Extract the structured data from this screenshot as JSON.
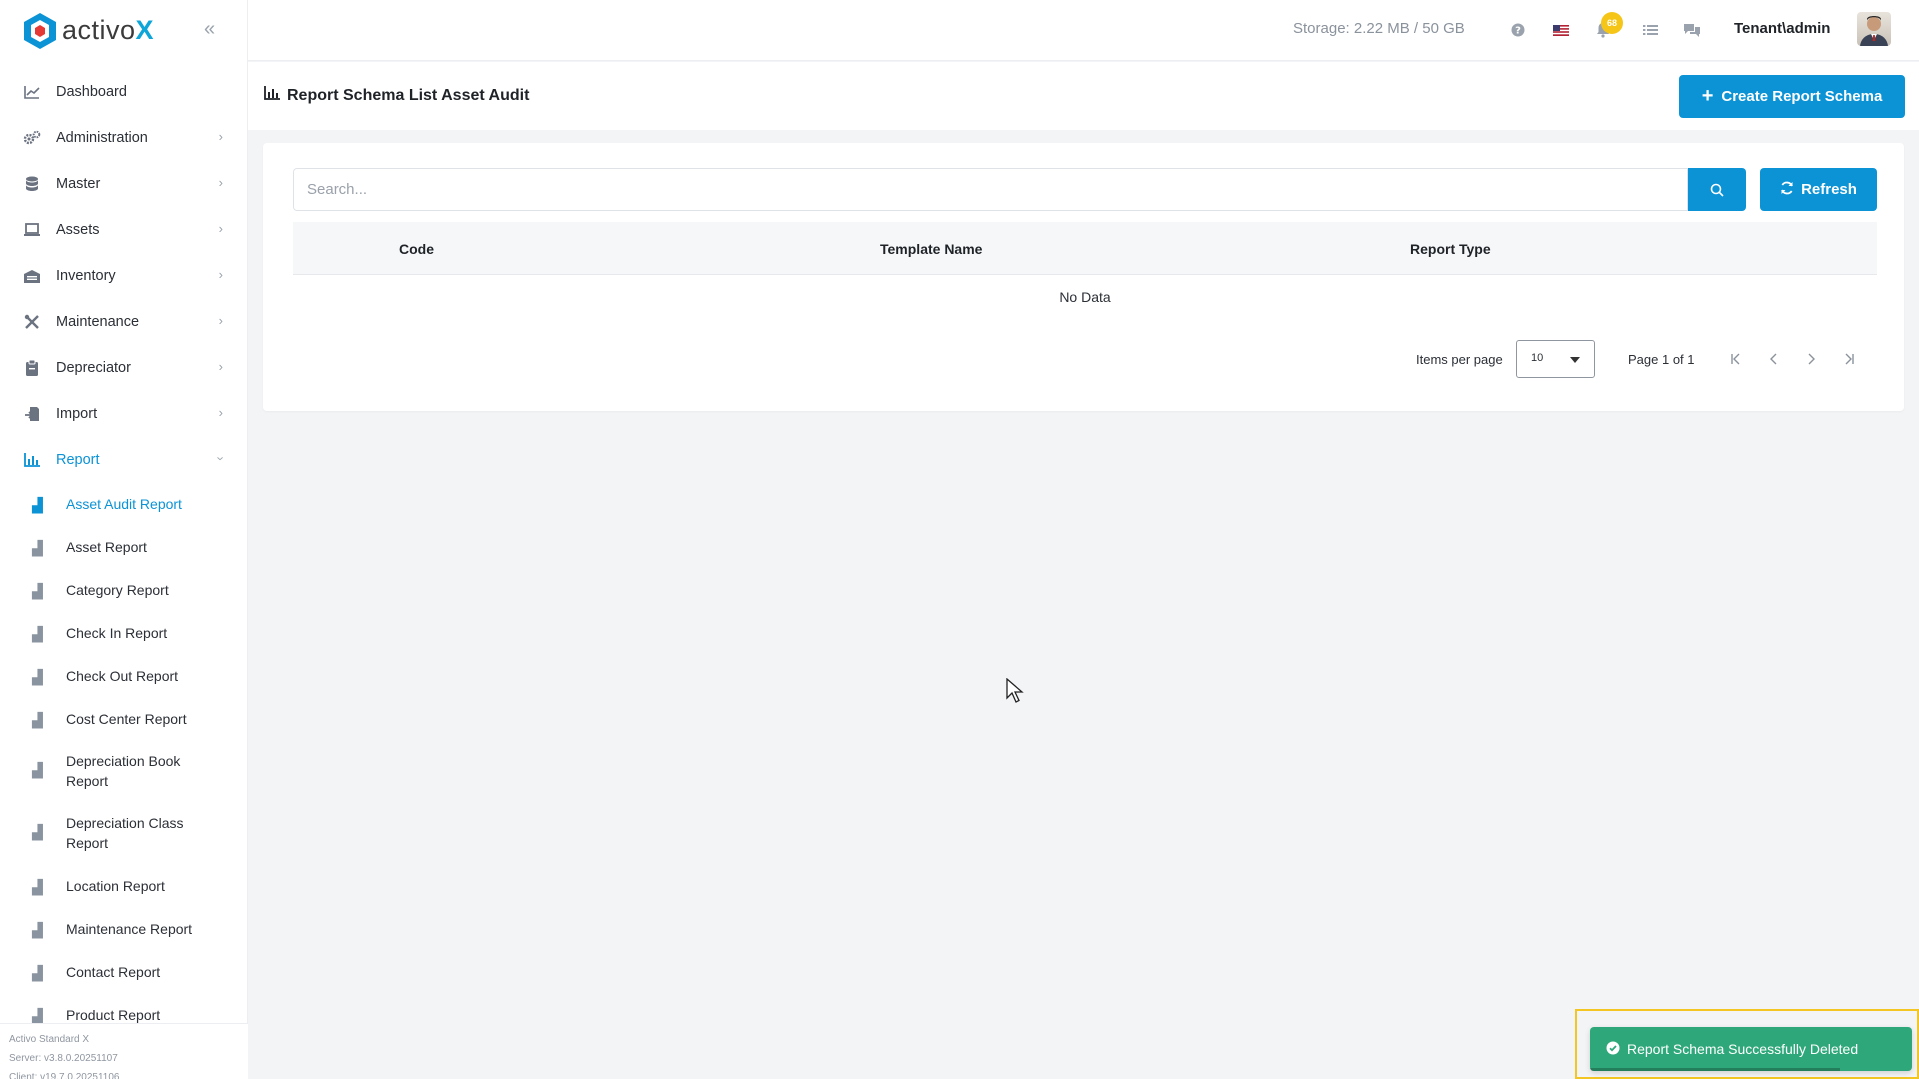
{
  "brand": {
    "logo_text_main": "activo",
    "logo_text_accent": "X",
    "accent_color": "#0b93d6"
  },
  "sidebar": {
    "items": [
      {
        "label": "Dashboard",
        "icon": "chart-line-icon",
        "has_children": false
      },
      {
        "label": "Administration",
        "icon": "gears-icon",
        "has_children": true
      },
      {
        "label": "Master",
        "icon": "database-icon",
        "has_children": true
      },
      {
        "label": "Assets",
        "icon": "laptop-icon",
        "has_children": true
      },
      {
        "label": "Inventory",
        "icon": "warehouse-icon",
        "has_children": true
      },
      {
        "label": "Maintenance",
        "icon": "tools-icon",
        "has_children": true
      },
      {
        "label": "Depreciator",
        "icon": "clipboard-icon",
        "has_children": true
      },
      {
        "label": "Import",
        "icon": "import-icon",
        "has_children": true
      },
      {
        "label": "Report",
        "icon": "bar-chart-icon",
        "has_children": true,
        "expanded": true
      }
    ],
    "report_sub_items": [
      "Asset Audit Report",
      "Asset Report",
      "Category Report",
      "Check In Report",
      "Check Out Report",
      "Cost Center Report",
      "Depreciation Book Report",
      "Depreciation Class Report",
      "Location Report",
      "Maintenance Report",
      "Contact Report",
      "Product Report"
    ],
    "active_sub_item": "Asset Audit Report",
    "footer": {
      "edition": "Activo Standard X",
      "server": "Server: v3.8.0.20251107",
      "client": "Client: v19.7.0.20251106"
    }
  },
  "topbar": {
    "storage": "Storage: 2.22 MB / 50 GB",
    "notification_count": "68",
    "user": "Tenant\\admin"
  },
  "page": {
    "title": "Report Schema List Asset Audit",
    "create_button": "Create Report Schema",
    "search_placeholder": "Search...",
    "refresh_button": "Refresh",
    "columns": [
      "Code",
      "Template Name",
      "Report Type"
    ],
    "empty_text": "No Data",
    "pagination": {
      "items_per_page_label": "Items per page",
      "items_per_page_value": "10",
      "page_info": "Page 1 of 1"
    }
  },
  "toast": {
    "message": "Report Schema Successfully Deleted",
    "color": "#2ea87a"
  }
}
